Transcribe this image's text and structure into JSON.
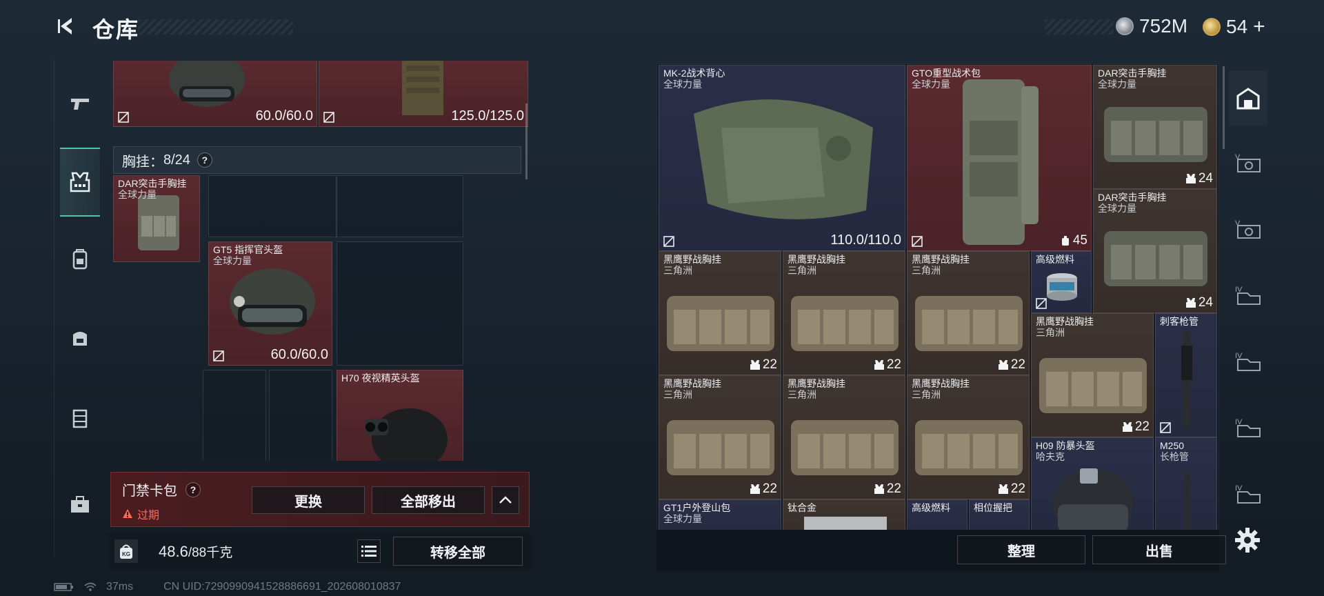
{
  "header": {
    "title": "仓库",
    "silver_amount": "752M",
    "gold_amount": "54",
    "gold_plus": "+"
  },
  "left_tabs": [
    "gun-icon",
    "vest-icon",
    "backpack-icon",
    "bag-icon",
    "container-icon",
    "case-icon"
  ],
  "left_panel": {
    "top_items": [
      {
        "value": "60.0/60.0"
      },
      {
        "value": "125.0/125.0"
      }
    ],
    "section": {
      "label": "胸挂：",
      "count": "8",
      "capacity": "/24",
      "help": "?"
    },
    "items": [
      {
        "name": "DAR突击手胸挂",
        "sub": "全球力量"
      },
      {
        "name": "GT5 指挥官头盔",
        "sub": "全球力量",
        "value": "60.0/60.0"
      },
      {
        "name": "H70 夜视精英头盔"
      }
    ]
  },
  "cardpack": {
    "name": "门禁卡包",
    "help": "?",
    "status": "过期",
    "replace_label": "更换",
    "move_all_label": "全部移出"
  },
  "weight": {
    "kg_label": "KG",
    "current": "48.6",
    "max": "/88千克"
  },
  "transfer_all_label": "转移全部",
  "status_bar": {
    "ping": "37ms",
    "uid": "CN UID:7290990941528886691_202608010837"
  },
  "right_panel": {
    "items": [
      {
        "name": "MK-2战术背心",
        "sub": "全球力量",
        "value": "110.0/110.0"
      },
      {
        "name": "GTO重型战术包",
        "sub": "全球力量",
        "count": "45"
      },
      {
        "name": "DAR突击手胸挂",
        "sub": "全球力量",
        "count": "24"
      },
      {
        "name": "DAR突击手胸挂",
        "sub": "全球力量",
        "count": "24"
      },
      {
        "name": "黑鹰野战胸挂",
        "sub": "三角洲",
        "count": "22"
      },
      {
        "name": "黑鹰野战胸挂",
        "sub": "三角洲",
        "count": "22"
      },
      {
        "name": "黑鹰野战胸挂",
        "sub": "三角洲",
        "count": "22"
      },
      {
        "name": "高级燃料"
      },
      {
        "name": "黑鹰野战胸挂",
        "sub": "三角洲",
        "count": "22"
      },
      {
        "name": "刺客枪管"
      },
      {
        "name": "黑鹰野战胸挂",
        "sub": "三角洲",
        "count": "22"
      },
      {
        "name": "黑鹰野战胸挂",
        "sub": "三角洲",
        "count": "22"
      },
      {
        "name": "黑鹰野战胸挂",
        "sub": "三角洲",
        "count": "22"
      },
      {
        "name": "H09 防暴头盔",
        "sub": "哈夫克"
      },
      {
        "name": "M250",
        "sub": "长枪管"
      },
      {
        "name": "GT1户外登山包",
        "sub": "全球力量"
      },
      {
        "name": "钛合金"
      },
      {
        "name": "高级燃料"
      },
      {
        "name": "相位握把"
      }
    ],
    "sort_label": "整理",
    "sell_label": "出售"
  },
  "right_tabs": [
    "home-storage-icon",
    "tier5-storage-icon",
    "tier5-storage-icon",
    "tier4-storage-icon",
    "tier4-storage-icon",
    "tier4-storage-icon",
    "tier4-storage-icon"
  ],
  "colors": {
    "accent": "#56c3a8",
    "expired": "#ff6a5a",
    "cell_red": "#4f2529",
    "cell_blue": "#262b43",
    "cell_brown": "#3a302c"
  }
}
